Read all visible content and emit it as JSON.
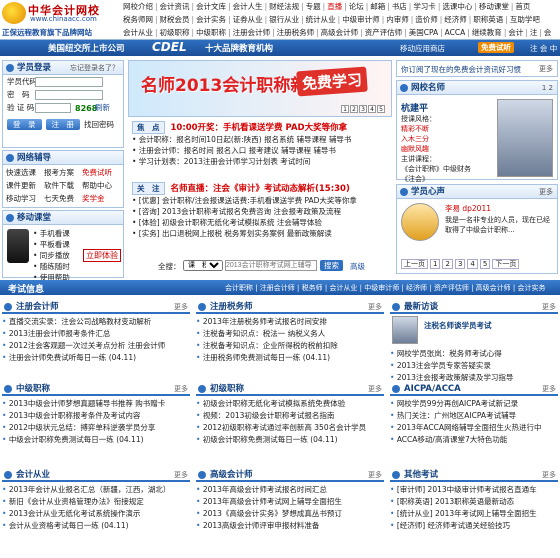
{
  "header": {
    "logo_name": "中华会计网校",
    "logo_url": "www.chinaacc.com",
    "slogan": "正保远程教育旗下品牌网站",
    "nav_rows": [
      [
        "网校介绍",
        "会计资讯",
        "会计文库",
        "会计人生",
        "财经法规",
        "专题",
        "直播",
        "论坛",
        "邮箱",
        "书店",
        "学习卡",
        "选课中心",
        "移动课堂",
        "首页"
      ],
      [
        "税务师网",
        "财税会员",
        "会计实务",
        "证券从业",
        "银行从业",
        "统计从业",
        "中级审计师",
        "内审师",
        "造价师",
        "经济师",
        "职称英语",
        "互助学吧"
      ],
      [
        "会计从业",
        "初级职称",
        "中级职称",
        "注册会计师",
        "注册税务师",
        "高级会计师",
        "资产评估师",
        "美国CPA",
        "ACCA",
        "继续教育",
        "会计",
        "注",
        "会"
      ]
    ]
  },
  "bar": {
    "left": "美国纽交所上市公司",
    "cdel": "CDEL",
    "right": "十大品牌教育机构",
    "mobile": "移动应用商店",
    "apply": "免费试听",
    "extra": "注 会 中"
  },
  "login": {
    "title": "学员登录",
    "forgot": "忘记登录名了？",
    "user_label": "学员代码",
    "pwd_label": "密　码",
    "code_label": "验 证 码",
    "code": "8268",
    "change": "刷新",
    "login_btn": "登　录",
    "reg_btn": "注　册",
    "find_pwd": "找回密码"
  },
  "guidance": {
    "title": "网络辅导",
    "items": [
      "快速选课",
      "报考方案",
      "免费试听",
      "课件更新",
      "软件下载",
      "帮助中心",
      "移动学习",
      "七天免费",
      "奖学金"
    ]
  },
  "mobile": {
    "title": "移动课堂",
    "items": [
      "手机看课",
      "平板看课",
      "同步播放",
      "随练随时",
      "使用帮助"
    ],
    "download": "立即体验"
  },
  "promo": {
    "text": "名师2013会计职称新课",
    "tag": "免费学习",
    "dots": [
      "1",
      "2",
      "3",
      "4",
      "5"
    ]
  },
  "focus": {
    "tag": "焦　点",
    "headline": "10:00开奖：手机看课送学费 PAD大奖等你拿",
    "lines": [
      "会计职称：报名时间10日起(新:陕西) 报名系统 辅导课程 辅导书",
      "注册会计师：报名时间 报名入口 报考建议 辅导课程 辅导书",
      "学习计划表：2013注册会计师学习计划表 考试时间"
    ]
  },
  "attention": {
    "tag": "关　注",
    "headline": "名师直播：注会《审计》考试动态解析(15:30)",
    "lines": [
      "[优惠] 会计职称/注会报课送话费:手机看课送学费 PAD大奖等你拿",
      "[咨询] 2013会计职称考试报名免费咨询 注会报考政策及流程",
      "[体验] 初级会计职称无纸化考试模拟系统 注会辅导体验",
      "[实务] 出口退税网上报税 税务筹划实务案例 最新政策解读"
    ]
  },
  "search": {
    "label": "全搜：",
    "select": "课　程",
    "placeholder": "2013会计职称考试网上辅导",
    "button": "搜索",
    "advanced": "高级"
  },
  "subscribe": {
    "text": "你订阅了现在的免费会计资讯好习惯",
    "more": "更多"
  },
  "teachers": {
    "title": "网校名师",
    "pages": "1 2",
    "name": "杭建平",
    "tags": [
      "授课风格：",
      "精彩不断",
      "入木三分",
      "幽默风趣",
      "主讲课程：",
      "《会计职称》中级财务",
      "《注会》"
    ]
  },
  "students": {
    "title": "学员心声",
    "more": "更多",
    "name": "李易 dp2011",
    "quote": "我是一名非专业的人员，现在已经取得了中级会计职称...",
    "pages": [
      "1",
      "2",
      "3",
      "4",
      "5"
    ],
    "prev": "上一页",
    "next": "下一页"
  },
  "infobar": {
    "title": "考试信息",
    "links": "会计职称 | 注册会计师 | 税务师 | 会计从业 | 中级审计师 | 经济师 | 资产评估师 | 高级会计师 | 会计实务"
  },
  "sections": {
    "cpa": {
      "title": "注册会计师",
      "more": "更多",
      "items": [
        "直播交流实录：注会公司战略教材变动解析",
        "2013注册会计师报考条件汇总",
        "2012注会客观题一次过关考点分析 注册会计师",
        "注册会计师免费试听每日一练 (04.11)"
      ]
    },
    "tax": {
      "title": "注册税务师",
      "more": "更多",
      "items": [
        "2013年注册税务师考试报名时间安排",
        "注税备考知识点：税法一 纳税义务人",
        "注税备考知识点：企业所得税的税前扣除",
        "注册税务师免费测试每日一练 (04.11)"
      ]
    },
    "zhiye": {
      "title": "最新访谈",
      "more": "更多",
      "interview": "注税名师谈学员考试",
      "items": [
        "网校学员张岚：税务师考试心得",
        "2013注会学员专家答疑实录",
        "2013注会报考政策解读及学习指导"
      ]
    },
    "mid": {
      "title": "中级职称",
      "more": "更多",
      "items": [
        "2013中级会计师梦想真题辅导书推荐 购书赠卡",
        "2013中级会计职称报考条件及考试内容",
        "2012中级状元总结：搏弈单科逆袭学员分享",
        "中级会计职称免费测试每日一练 (04.11)"
      ]
    },
    "junior": {
      "title": "初级职称",
      "more": "更多",
      "items": [
        "初级会计职称无纸化考试模拟系统免费体验",
        "视频：2013初级会计职称考试报名指南",
        "2012初级职称考试通过率创新高 350名会计学员",
        "初级会计职称免费测试每日一练 (04.11)"
      ]
    },
    "acca": {
      "title": "AICPA/ACCA",
      "more": "更多",
      "items": [
        "网校学员99分再创AICPA考试新记录",
        "热门关注：广州地区AICPA考试辅导",
        "2013年ACCA网络辅导全面招生火热进行中",
        "ACCA移动/高清课堂7大特色功能"
      ]
    },
    "basic": {
      "title": "会计从业",
      "more": "更多",
      "items": [
        "2013年会计从业报名汇总（新疆，江西，湖北）",
        "新旧《会计从业资格管理办法》衔接规定",
        "2013会计从业无纸化考试系统操作演示",
        "会计从业资格考试每日一练 (04.11)"
      ]
    },
    "senior": {
      "title": "高级会计师",
      "more": "更多",
      "items": [
        "2013年高级会计师考试报名时间汇总",
        "2013年高级会计师考试网上辅导全面招生",
        "2013《高级会计实务》梦想成真丛书预订",
        "2013高级会计师评审申报材料准备"
      ]
    },
    "other": {
      "title": "其他考试",
      "more": "更多",
      "items": [
        "[审计师] 2013中级审计师考试报名直通车",
        "[职称英语] 2013职称英语最新动态",
        "[统计从业] 2013年考试网上辅导全面招生",
        "[经济师] 经济师考试通关经验技巧"
      ]
    }
  }
}
